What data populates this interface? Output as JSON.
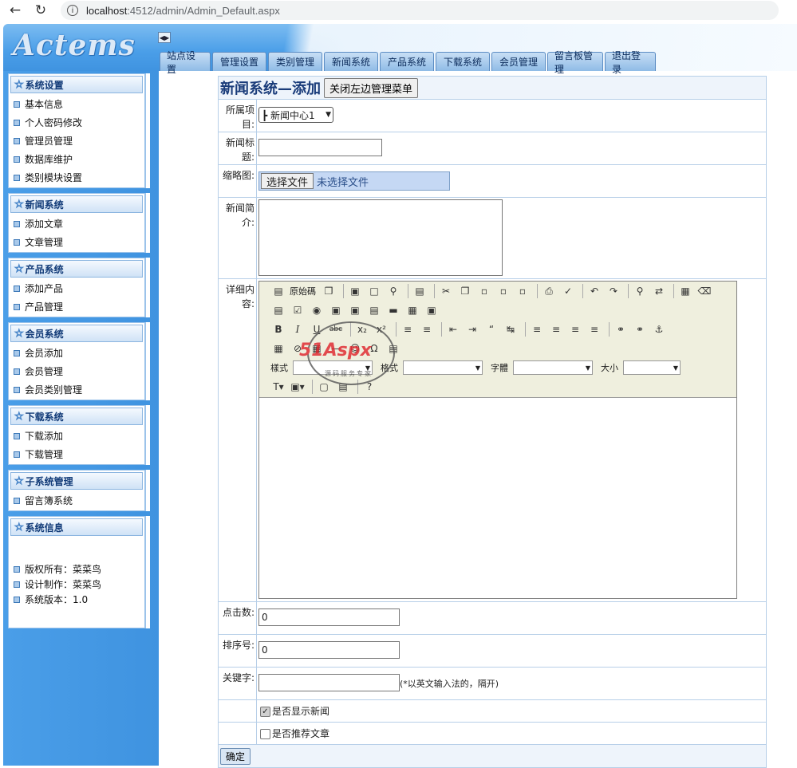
{
  "browser": {
    "url_host": "localhost",
    "url_rest": ":4512/admin/Admin_Default.aspx"
  },
  "header": {
    "logo": "Actems",
    "tabs": [
      "站点设置",
      "管理设置",
      "类别管理",
      "新闻系统",
      "产品系统",
      "下载系统",
      "会员管理",
      "留言板管理",
      "退出登录"
    ]
  },
  "sidebar": {
    "sections": [
      {
        "title": "系统设置",
        "items": [
          "基本信息",
          "个人密码修改",
          "管理员管理",
          "数据库维护",
          "类别模块设置"
        ]
      },
      {
        "title": "新闻系统",
        "items": [
          "添加文章",
          "文章管理"
        ]
      },
      {
        "title": "产品系统",
        "items": [
          "添加产品",
          "产品管理"
        ]
      },
      {
        "title": "会员系统",
        "items": [
          "会员添加",
          "会员管理",
          "会员类别管理"
        ]
      },
      {
        "title": "下载系统",
        "items": [
          "下载添加",
          "下载管理"
        ]
      },
      {
        "title": "子系统管理",
        "items": [
          "留言簿系统"
        ]
      },
      {
        "title": "系统信息",
        "items": [
          "版权所有：菜菜鸟",
          "设计制作：菜菜鸟",
          "系统版本：1.0"
        ]
      }
    ]
  },
  "form": {
    "page_title": "新闻系统—添加",
    "close_menu_button": "关闭左边管理菜单",
    "category_label": "所属项目:",
    "category_value": "┣ 新闻中心1",
    "title_label": "新闻标题:",
    "thumb_label": "缩略图:",
    "file_button": "选择文件",
    "file_status": "未选择文件",
    "intro_label": "新闻简介:",
    "content_label": "详细内容:",
    "clicks_label": "点击数:",
    "clicks_value": "0",
    "order_label": "排序号:",
    "order_value": "0",
    "keywords_label": "关键字:",
    "keywords_hint": "(*以英文输入法的，隔开)",
    "show_checkbox": "是否显示新闻",
    "recommend_checkbox": "是否推荐文章",
    "submit_button": "确定"
  },
  "editor": {
    "source_label": "原始碼",
    "style_label": "樣式",
    "format_label": "格式",
    "font_label": "字體",
    "size_label": "大小",
    "watermark": "51Aspx",
    "watermark_sub": "源码服务专家"
  }
}
